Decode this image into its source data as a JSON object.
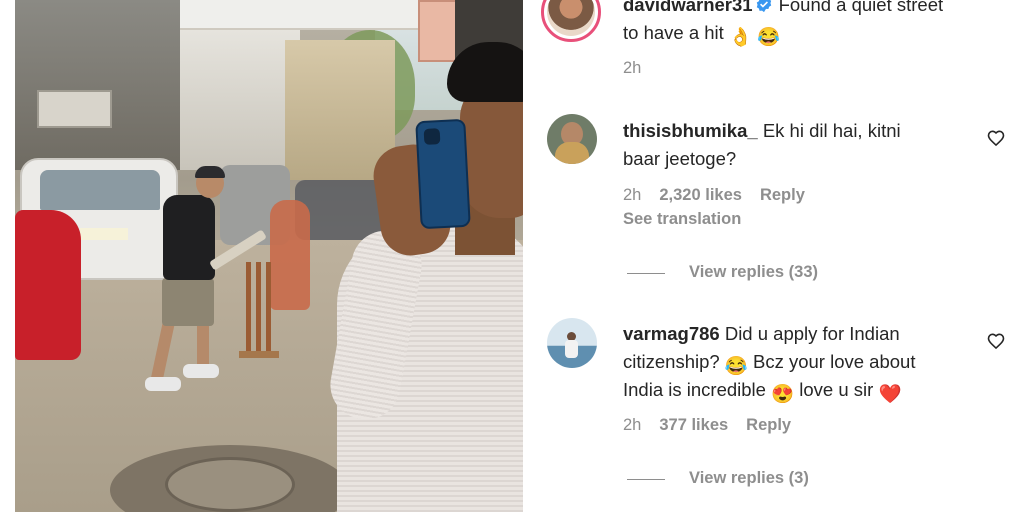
{
  "post": {
    "caption_user": "davidwarner31",
    "caption_text_line1": "Found a quiet street",
    "caption_text_line2": "to have a hit",
    "caption_emoji1": "👌",
    "caption_emoji2": "😂",
    "caption_time": "2h"
  },
  "comments": [
    {
      "username": "thisisbhumika_",
      "text_line1": "Ek hi dil hai, kitni",
      "text_line2": "baar jeetoge?",
      "time": "2h",
      "likes": "2,320 likes",
      "reply": "Reply",
      "see_translation": "See translation",
      "view_replies": "View replies (33)"
    },
    {
      "username": "varmag786",
      "text_line1": "Did u apply for Indian",
      "text_line2a": "citizenship?",
      "emoji_a": "😂",
      "text_line2b": "Bcz your love about",
      "text_line3a": "India is incredible",
      "emoji_b": "😍",
      "text_line3b": "love u sir",
      "emoji_c": "❤️",
      "time": "2h",
      "likes": "377 likes",
      "reply": "Reply",
      "view_replies": "View replies (3)"
    }
  ],
  "colors": {
    "text": "#262626",
    "secondary": "#8e8e8e",
    "verified": "#3897f0",
    "story_ring": "#e8507a"
  },
  "icons": {
    "verified": "verified-badge-icon",
    "like": "heart-outline-icon"
  }
}
